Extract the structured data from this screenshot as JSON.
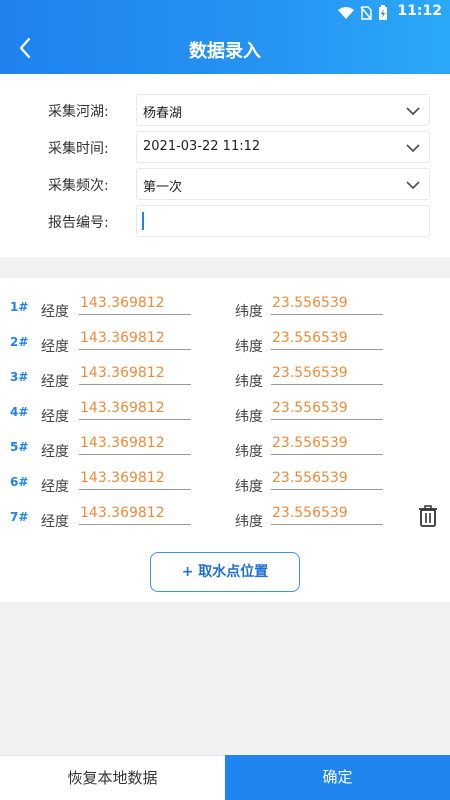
{
  "status": {
    "time": "11:12"
  },
  "header": {
    "title": "数据录入"
  },
  "form": {
    "river": {
      "label": "采集河湖:",
      "value": "杨春湖"
    },
    "time": {
      "label": "采集时间:",
      "value": "2021-03-22 11:12"
    },
    "frequency": {
      "label": "采集频次:",
      "value": "第一次"
    },
    "report": {
      "label": "报告编号:",
      "value": ""
    }
  },
  "points": {
    "lng_label": "经度",
    "lat_label": "纬度",
    "rows": [
      {
        "index": "1#",
        "lng": "143.369812",
        "lat": "23.556539"
      },
      {
        "index": "2#",
        "lng": "143.369812",
        "lat": "23.556539"
      },
      {
        "index": "3#",
        "lng": "143.369812",
        "lat": "23.556539"
      },
      {
        "index": "4#",
        "lng": "143.369812",
        "lat": "23.556539"
      },
      {
        "index": "5#",
        "lng": "143.369812",
        "lat": "23.556539"
      },
      {
        "index": "6#",
        "lng": "143.369812",
        "lat": "23.556539"
      },
      {
        "index": "7#",
        "lng": "143.369812",
        "lat": "23.556539"
      }
    ],
    "add_label": "+ 取水点位置"
  },
  "footer": {
    "restore_label": "恢复本地数据",
    "confirm_label": "确定"
  },
  "colors": {
    "primary": "#1f82ef",
    "value": "#f08a3a"
  }
}
